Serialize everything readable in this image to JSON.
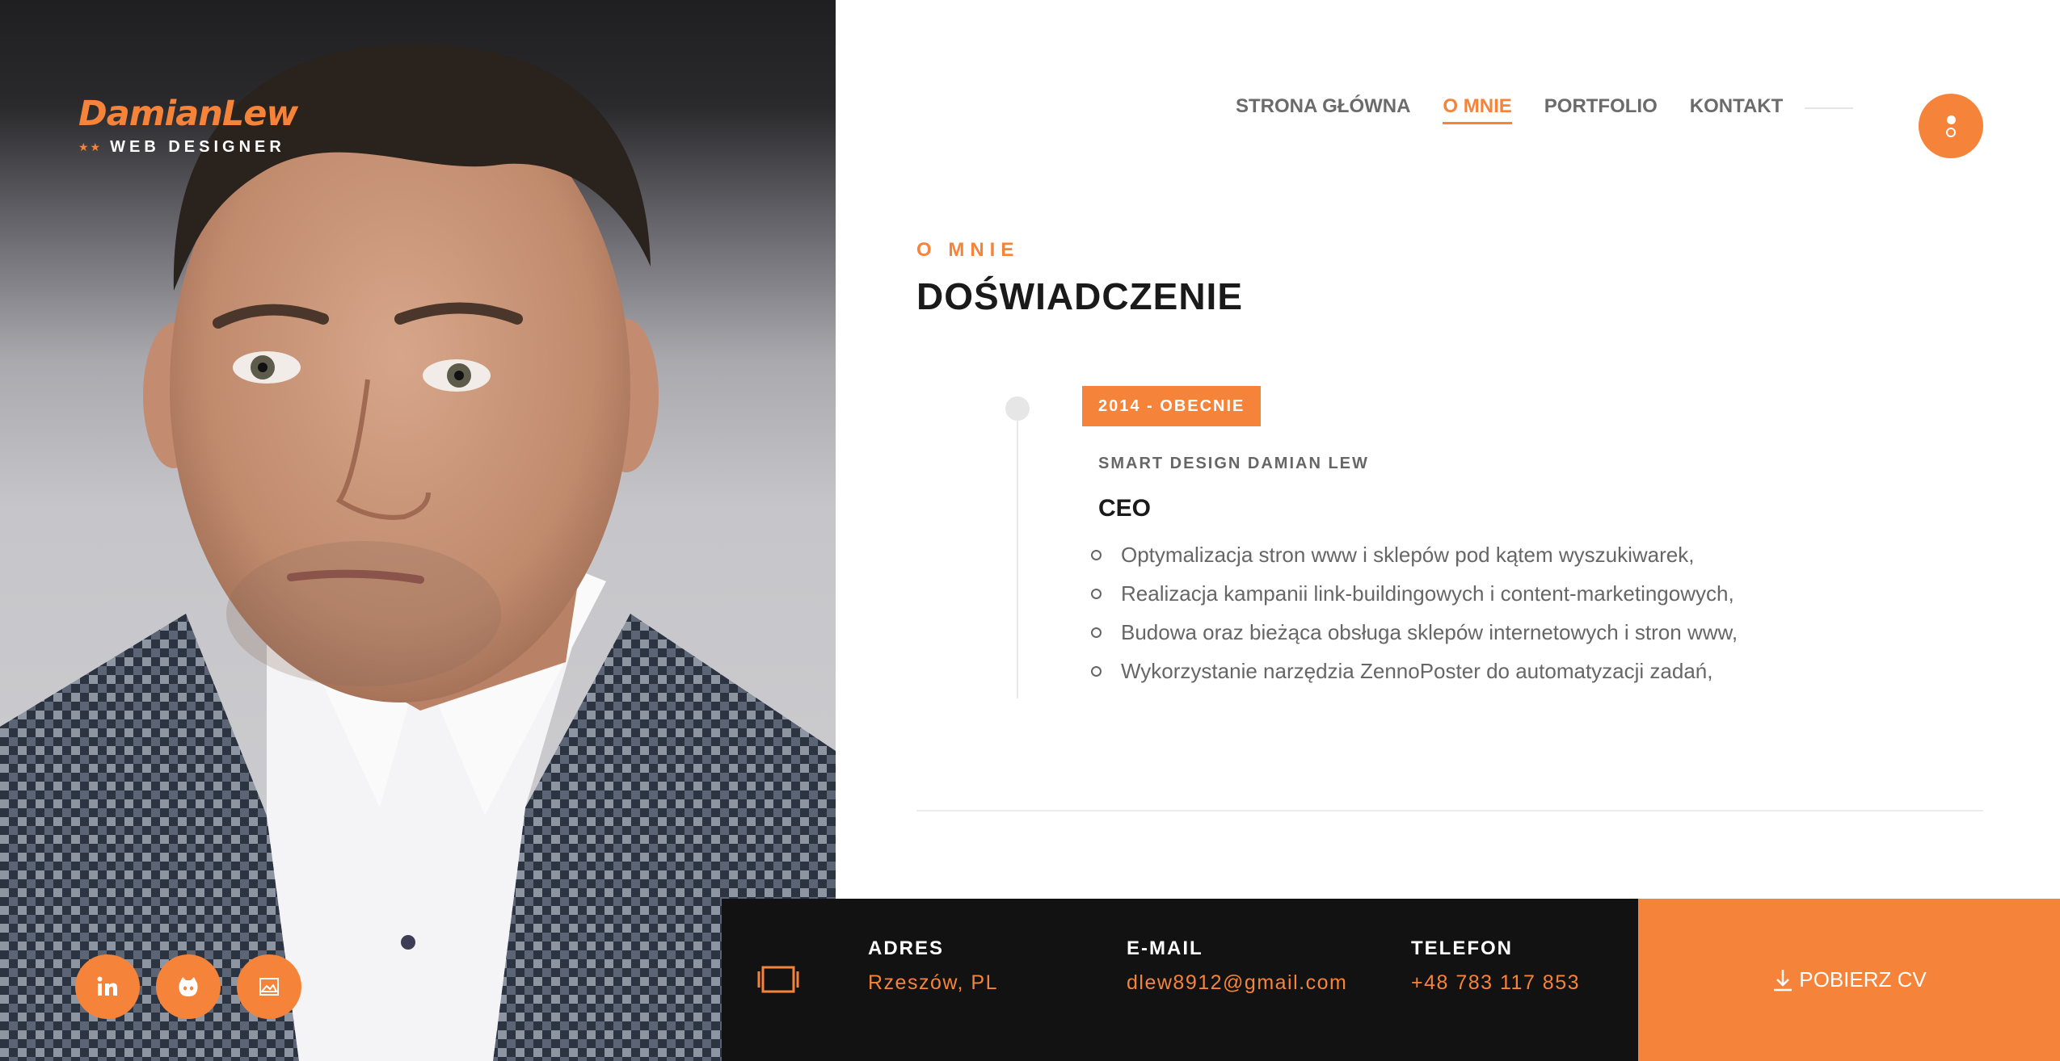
{
  "brand": {
    "name": "DamianLew",
    "stars": "★★",
    "tagline": "WEB DESIGNER"
  },
  "nav": {
    "items": [
      {
        "label": "STRONA GŁÓWNA",
        "active": false
      },
      {
        "label": "O MNIE",
        "active": true
      },
      {
        "label": "PORTFOLIO",
        "active": false
      },
      {
        "label": "KONTAKT",
        "active": false
      }
    ]
  },
  "section": {
    "subtitle": "O MNIE",
    "title": "DOŚWIADCZENIE"
  },
  "experience": {
    "date": "2014 - OBECNIE",
    "company": "SMART DESIGN DAMIAN LEW",
    "role": "CEO",
    "duties": [
      "Optymalizacja stron www i sklepów pod kątem wyszukiwarek,",
      "Realizacja kampanii link-buildingowych i content-marketingowych,",
      "Budowa oraz bieżąca obsługa sklepów internetowych i stron www,",
      "Wykorzystanie narzędzia ZennoPoster do automatyzacji zadań,"
    ]
  },
  "social": [
    {
      "icon": "linkedin-icon"
    },
    {
      "icon": "github-icon"
    },
    {
      "icon": "image-icon"
    }
  ],
  "footer": {
    "address": {
      "label": "ADRES",
      "value": "Rzeszów, PL"
    },
    "email": {
      "label": "E-MAIL",
      "value": "dlew8912@gmail.com"
    },
    "phone": {
      "label": "TELEFON",
      "value": "+48 783 117 853"
    }
  },
  "cv_button": {
    "label": "POBIERZ CV"
  },
  "colors": {
    "accent": "#f5843a",
    "footer_bg": "#121212",
    "text_dark": "#1a1a1a",
    "text_muted": "#666666"
  }
}
